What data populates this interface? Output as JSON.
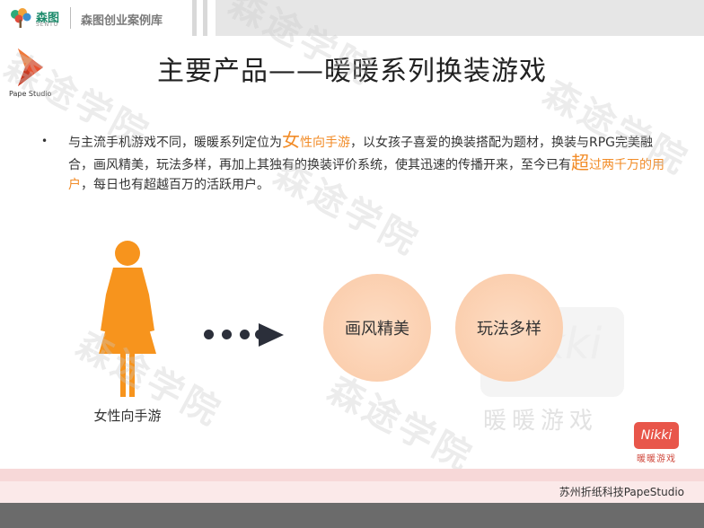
{
  "header": {
    "logo_name": "森图",
    "logo_sub": "SENTU",
    "title": "森图创业案例库"
  },
  "brand": {
    "pape_label": "Pape Studio"
  },
  "slide": {
    "title": "主要产品——暖暖系列换装游戏",
    "bullet": "•",
    "para": {
      "p1": "与主流手机游戏不同，暖暖系列定位为",
      "h1a": "女",
      "h1b": "性向手游",
      "p2": "，以女孩子喜爱的换装搭配为题材，换装与RPG完美融合，画风精美，玩法多样，再加上其独有的换装评价系统，使其迅速的传播开来，至今已有",
      "h2a": "超",
      "h2b": "过两千万的用户",
      "p3": "，每日也有超越百万的活跃用户。"
    },
    "figure_label": "女性向手游",
    "circles": [
      "画风精美",
      "玩法多样"
    ],
    "watermark_card": "Nikki",
    "watermark_game": "暖暖游戏"
  },
  "nikki_logo": {
    "text": "Nikki",
    "sub": "暖暖游戏"
  },
  "footer": {
    "text": "苏州折纸科技PapeStudio"
  },
  "watermarks": [
    "森途学院",
    "森途学院",
    "森途学院",
    "森途学院",
    "森途学院",
    "森途学院"
  ],
  "colors": {
    "accent": "#f28c28",
    "figure": "#f7941d",
    "circle": "#fbcfaf",
    "nikki": "#e8564a"
  },
  "icons": {
    "header_logo": "tree-logo-icon",
    "pape_logo": "pape-studio-arrow-icon",
    "figure": "woman-figure-icon",
    "arrow": "arrow-right-icon"
  }
}
